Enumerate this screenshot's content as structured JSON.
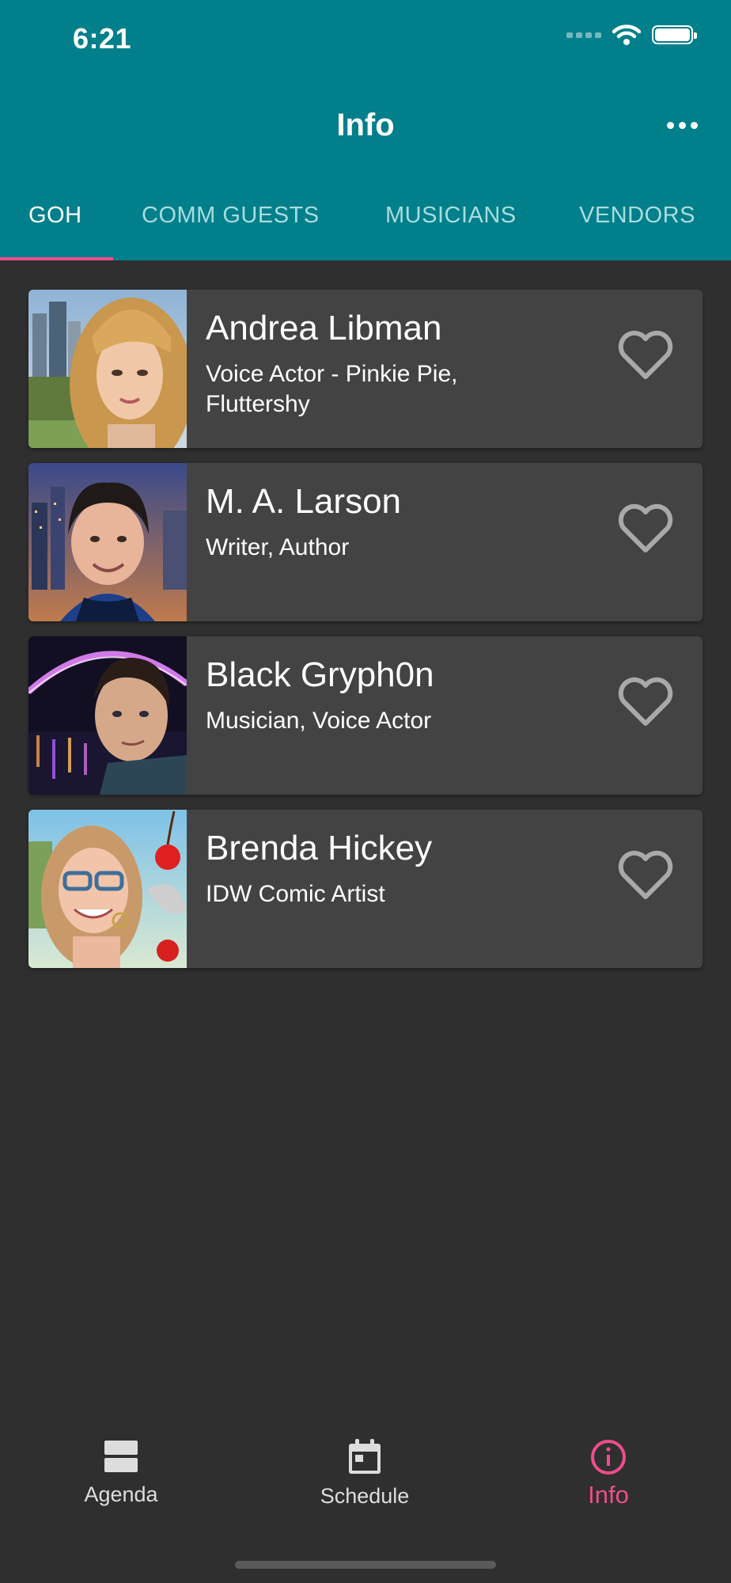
{
  "status_bar": {
    "time": "6:21"
  },
  "header": {
    "title": "Info"
  },
  "tabs": [
    {
      "label": "GOH",
      "active": true
    },
    {
      "label": "COMM GUESTS",
      "active": false
    },
    {
      "label": "MUSICIANS",
      "active": false
    },
    {
      "label": "VENDORS",
      "active": false
    }
  ],
  "guests": [
    {
      "name": "Andrea Libman",
      "role": "Voice Actor - Pinkie Pie, Fluttershy",
      "favorited": false
    },
    {
      "name": "M. A. Larson",
      "role": "Writer, Author",
      "favorited": false
    },
    {
      "name": "Black Gryph0n",
      "role": "Musician, Voice Actor",
      "favorited": false
    },
    {
      "name": "Brenda Hickey",
      "role": "IDW Comic Artist",
      "favorited": false
    }
  ],
  "bottom_nav": [
    {
      "label": "Agenda",
      "icon": "agenda-icon",
      "active": false
    },
    {
      "label": "Schedule",
      "icon": "calendar-icon",
      "active": false
    },
    {
      "label": "Info",
      "icon": "info-icon",
      "active": true
    }
  ],
  "colors": {
    "header_bg": "#017f8a",
    "accent": "#ef4d8c",
    "background": "#2f2f2f",
    "card_bg": "#434343"
  }
}
